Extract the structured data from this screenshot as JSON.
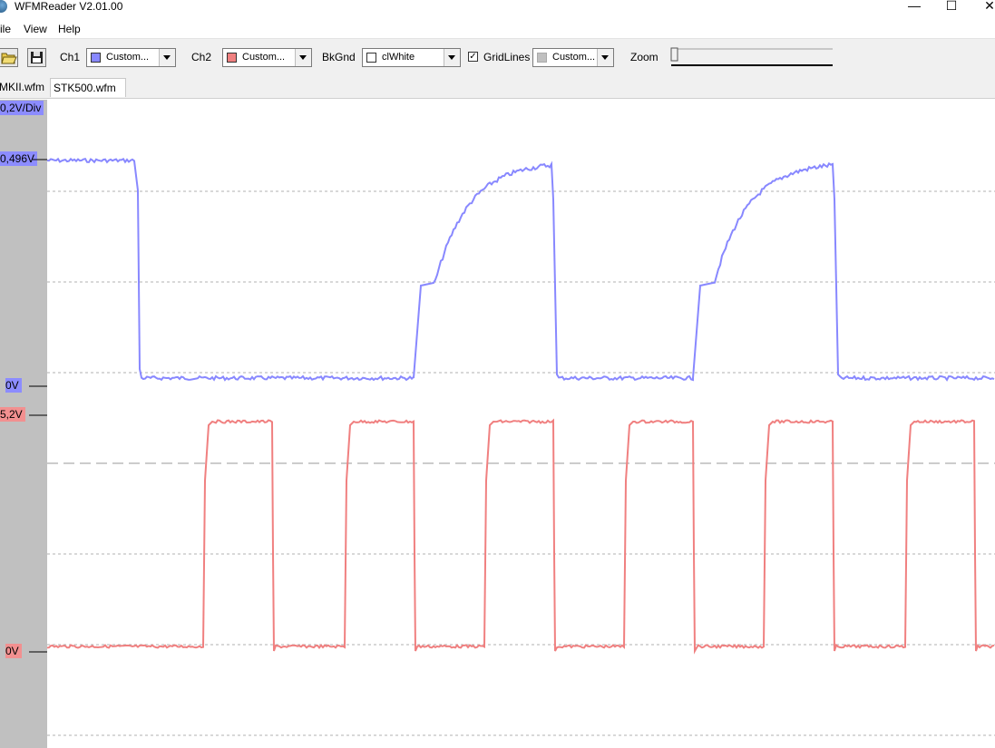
{
  "window": {
    "title": "WFMReader V2.01.00",
    "minimize_glyph": "—",
    "maximize_glyph": "☐",
    "close_glyph": "✕"
  },
  "menu": [
    "ile",
    "View",
    "Help"
  ],
  "toolbar": {
    "open_icon": "open-folder-icon",
    "save_icon": "save-disk-icon",
    "ch1_label": "Ch1",
    "ch1_value": "Custom...",
    "ch1_color": "#8888ff",
    "ch2_label": "Ch2",
    "ch2_value": "Custom...",
    "ch2_color": "#f08080",
    "bkgnd_label": "BkGnd",
    "bkgnd_value": "clWhite",
    "bkgnd_color": "#ffffff",
    "gridlines_label": "GridLines",
    "gridlines_checked": true,
    "grid_color_value": "Custom...",
    "grid_color": "#c0c0c0",
    "zoom_label": "Zoom",
    "zoom_level": 0
  },
  "tabs": [
    {
      "label": "MKII.wfm",
      "active": false
    },
    {
      "label": "STK500.wfm",
      "active": true
    }
  ],
  "scale": {
    "div_label": "0,2V/Div",
    "ch1_top": "0,496V",
    "ch1_zero": "0V",
    "ch2_top": "5,2V",
    "ch2_zero": "0V"
  },
  "colors": {
    "ch1": "#8888ff",
    "ch2": "#f08080",
    "ch1_label_bg": "#8c8cff",
    "ch2_label_bg": "#f29090"
  }
}
